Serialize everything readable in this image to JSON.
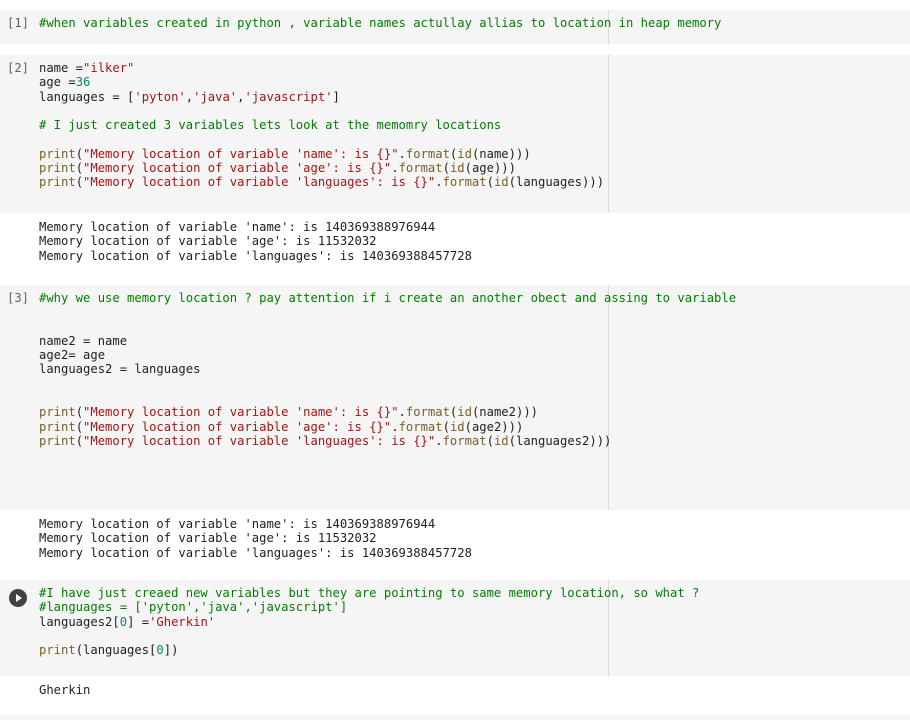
{
  "cells": [
    {
      "exec_count": "[1]",
      "lines": [
        [
          {
            "t": "#when variables created in python , variable names actullay allias to location in heap memory",
            "c": "cmt"
          }
        ]
      ]
    },
    {
      "exec_count": "[2]",
      "lines": [
        [
          {
            "t": "name ="
          },
          {
            "t": "\"ilker\"",
            "c": "str"
          }
        ],
        [
          {
            "t": "age ="
          },
          {
            "t": "36",
            "c": "num"
          }
        ],
        [
          {
            "t": "languages = ["
          },
          {
            "t": "'pyton'",
            "c": "str"
          },
          {
            "t": ","
          },
          {
            "t": "'java'",
            "c": "str"
          },
          {
            "t": ","
          },
          {
            "t": "'javascript'",
            "c": "str"
          },
          {
            "t": "]"
          }
        ],
        [],
        [
          {
            "t": "# I just created 3 variables lets look at the memomry locations",
            "c": "cmt"
          }
        ],
        [],
        [
          {
            "t": "print",
            "c": "fn"
          },
          {
            "t": "("
          },
          {
            "t": "\"Memory location of variable 'name': is {}\"",
            "c": "str"
          },
          {
            "t": "."
          },
          {
            "t": "format",
            "c": "fn"
          },
          {
            "t": "("
          },
          {
            "t": "id",
            "c": "fn"
          },
          {
            "t": "(name)))"
          }
        ],
        [
          {
            "t": "print",
            "c": "fn"
          },
          {
            "t": "("
          },
          {
            "t": "\"Memory location of variable 'age': is {}\"",
            "c": "str"
          },
          {
            "t": "."
          },
          {
            "t": "format",
            "c": "fn"
          },
          {
            "t": "("
          },
          {
            "t": "id",
            "c": "fn"
          },
          {
            "t": "(age)))"
          }
        ],
        [
          {
            "t": "print",
            "c": "fn"
          },
          {
            "t": "("
          },
          {
            "t": "\"Memory location of variable 'languages': is {}\"",
            "c": "str"
          },
          {
            "t": "."
          },
          {
            "t": "format",
            "c": "fn"
          },
          {
            "t": "("
          },
          {
            "t": "id",
            "c": "fn"
          },
          {
            "t": "(languages)))"
          }
        ]
      ],
      "output": [
        "Memory location of variable 'name': is 140369388976944",
        "Memory location of variable 'age': is 11532032",
        "Memory location of variable 'languages': is 140369388457728"
      ]
    },
    {
      "exec_count": "[3]",
      "lines": [
        [
          {
            "t": "#why we use memory location ? pay attention if i create an another obect and assing to variable",
            "c": "cmt"
          }
        ],
        [],
        [],
        [
          {
            "t": "name2 = name"
          }
        ],
        [
          {
            "t": "age2= age"
          }
        ],
        [
          {
            "t": "languages2 = languages"
          }
        ],
        [],
        [],
        [
          {
            "t": "print",
            "c": "fn"
          },
          {
            "t": "("
          },
          {
            "t": "\"Memory location of variable 'name': is {}\"",
            "c": "str"
          },
          {
            "t": "."
          },
          {
            "t": "format",
            "c": "fn"
          },
          {
            "t": "("
          },
          {
            "t": "id",
            "c": "fn"
          },
          {
            "t": "(name2)))"
          }
        ],
        [
          {
            "t": "print",
            "c": "fn"
          },
          {
            "t": "("
          },
          {
            "t": "\"Memory location of variable 'age': is {}\"",
            "c": "str"
          },
          {
            "t": "."
          },
          {
            "t": "format",
            "c": "fn"
          },
          {
            "t": "("
          },
          {
            "t": "id",
            "c": "fn"
          },
          {
            "t": "(age2)))"
          }
        ],
        [
          {
            "t": "print",
            "c": "fn"
          },
          {
            "t": "("
          },
          {
            "t": "\"Memory location of variable 'languages': is {}\"",
            "c": "str"
          },
          {
            "t": "."
          },
          {
            "t": "format",
            "c": "fn"
          },
          {
            "t": "("
          },
          {
            "t": "id",
            "c": "fn"
          },
          {
            "t": "(languages2)))"
          }
        ]
      ],
      "output": [
        "Memory location of variable 'name': is 140369388976944",
        "Memory location of variable 'age': is 11532032",
        "Memory location of variable 'languages': is 140369388457728"
      ]
    },
    {
      "exec_count": "",
      "lines": [
        [
          {
            "t": "#I have just creaed new variables but they are pointing to same memory location, so what ?",
            "c": "cmt"
          }
        ],
        [
          {
            "t": "#languages = ['pyton','java','javascript']",
            "c": "cmt"
          }
        ],
        [
          {
            "t": "languages2["
          },
          {
            "t": "0",
            "c": "num"
          },
          {
            "t": "] ="
          },
          {
            "t": "'Gherkin'",
            "c": "str"
          }
        ],
        [],
        [
          {
            "t": "print",
            "c": "fn"
          },
          {
            "t": "(languages["
          },
          {
            "t": "0",
            "c": "num"
          },
          {
            "t": "])"
          }
        ]
      ],
      "output": [
        "Gherkin"
      ]
    }
  ]
}
